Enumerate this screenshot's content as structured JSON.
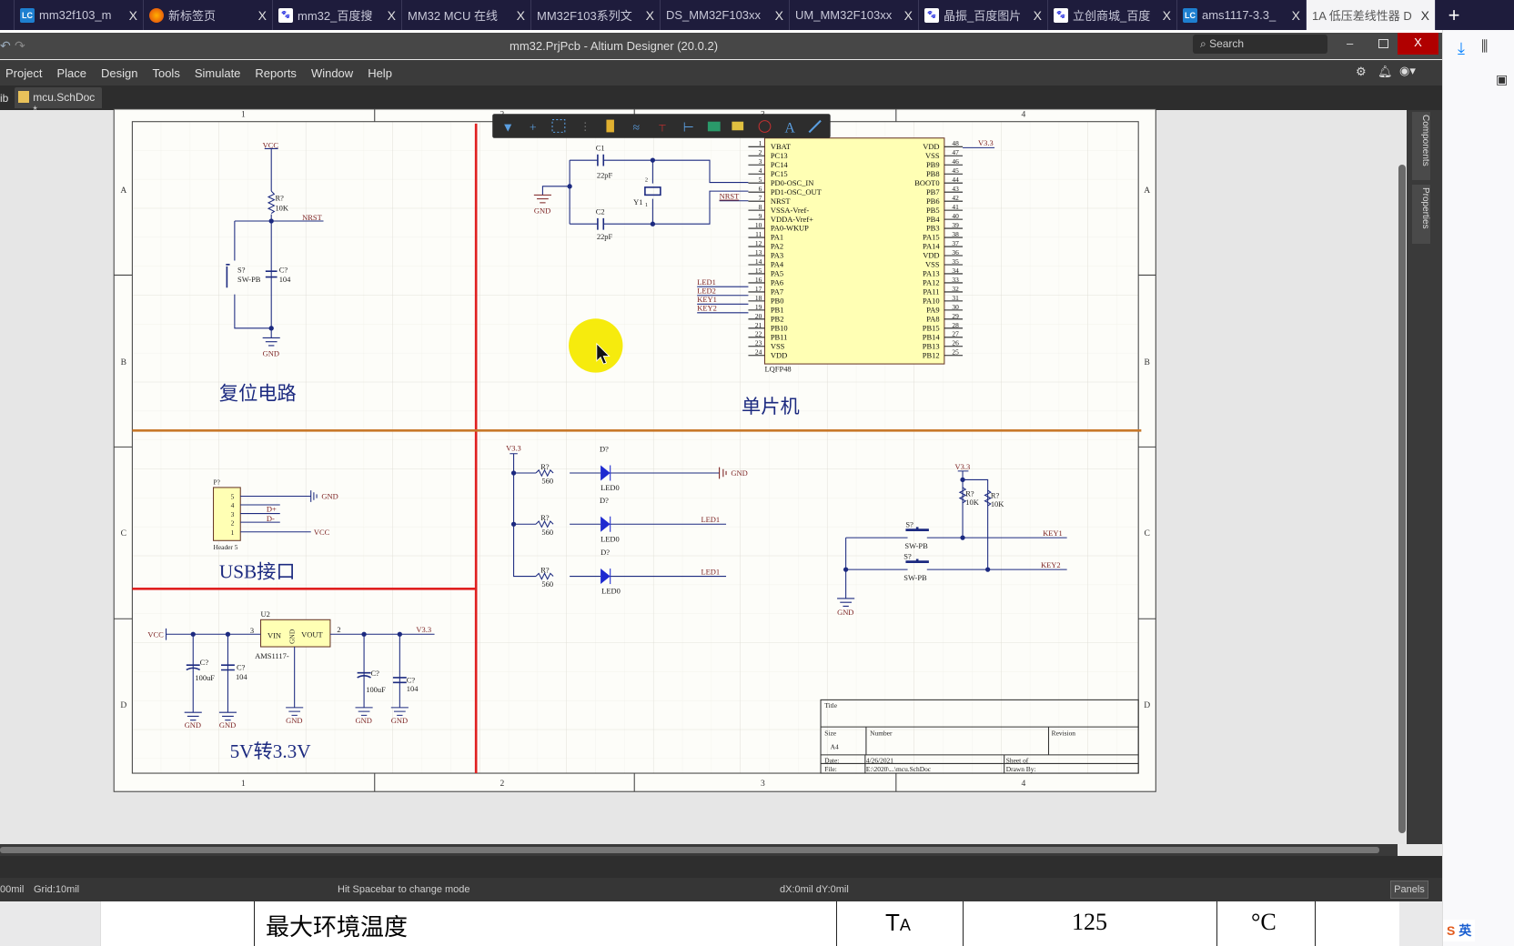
{
  "browser": {
    "tabs": [
      {
        "label": "mm32f103_m",
        "icon": "lc"
      },
      {
        "label": "新标签页",
        "icon": "firefox"
      },
      {
        "label": "mm32_百度搜",
        "icon": "baidu"
      },
      {
        "label": "MM32 MCU 在线",
        "icon": ""
      },
      {
        "label": "MM32F103系列文",
        "icon": ""
      },
      {
        "label": "DS_MM32F103xx",
        "icon": ""
      },
      {
        "label": "UM_MM32F103xx",
        "icon": ""
      },
      {
        "label": "晶振_百度图片",
        "icon": "baidu"
      },
      {
        "label": "立创商城_百度",
        "icon": "baidu"
      },
      {
        "label": "ams1117-3.3_",
        "icon": "lc"
      },
      {
        "label": "1A 低压差线性器 D",
        "icon": "",
        "active": true
      }
    ],
    "new_tab": "+",
    "close": "X",
    "ime": "英"
  },
  "app": {
    "title": "mm32.PrjPcb - Altium Designer (20.0.2)",
    "search_placeholder": "Search",
    "menu": [
      "Project",
      "Place",
      "Design",
      "Tools",
      "Simulate",
      "Reports",
      "Window",
      "Help"
    ],
    "doc_tabs": [
      "ib",
      "mcu.SchDoc *"
    ],
    "side_panels": [
      "Components",
      "Properties"
    ]
  },
  "status": {
    "snap": "00mil",
    "grid": "Grid:10mil",
    "hint": "Hit Spacebar to change mode",
    "delta": "dX:0mil dY:0mil",
    "panels": "Panels"
  },
  "doc_row": {
    "param": "最大环境温度",
    "symbol": "T",
    "symbol_sub": "A",
    "value": "125",
    "unit": "°C"
  },
  "sheet": {
    "columns": [
      "1",
      "2",
      "3",
      "4"
    ],
    "rows": [
      "A",
      "B",
      "C",
      "D"
    ],
    "sections": {
      "reset": "复位电路",
      "mcu": "单片机",
      "usb": "USB接口",
      "power": "5V转3.3V"
    },
    "title_block": {
      "title": "Title",
      "size": "Size",
      "size_value": "A4",
      "number": "Number",
      "revision": "Revision",
      "date": "Date:",
      "date_value": "4/26/2021",
      "file": "File:",
      "file_value": "E:\\2020\\...\\mcu.SchDoc",
      "sheet": "Sheet   of",
      "drawn_by": "Drawn By:"
    }
  },
  "reset": {
    "vcc": "VCC",
    "r_des": "R?",
    "r_val": "10K",
    "net": "NRST",
    "s_des": "S?",
    "s_val": "SW-PB",
    "c_des": "C?",
    "c_val": "104",
    "gnd": "GND"
  },
  "crystal": {
    "c1": "C1",
    "c1_val": "22pF",
    "c2": "C2",
    "c2_val": "22pF",
    "y1": "Y1",
    "pin2": "2",
    "pin1": "1",
    "gnd": "GND",
    "nrst": "NRST"
  },
  "mcu": {
    "package": "LQFP48",
    "power_net": "V3.3",
    "left_nets": [
      "LED1",
      "LED2",
      "KEY1",
      "KEY2"
    ],
    "left_pins": [
      [
        "1",
        "VBAT"
      ],
      [
        "2",
        "PC13"
      ],
      [
        "3",
        "PC14"
      ],
      [
        "4",
        "PC15"
      ],
      [
        "5",
        "PD0-OSC_IN"
      ],
      [
        "6",
        "PD1-OSC_OUT"
      ],
      [
        "7",
        "NRST"
      ],
      [
        "8",
        "VSSA-Vref-"
      ],
      [
        "9",
        "VDDA-Vref+"
      ],
      [
        "10",
        "PA0-WKUP"
      ],
      [
        "11",
        "PA1"
      ],
      [
        "12",
        "PA2"
      ],
      [
        "13",
        "PA3"
      ],
      [
        "14",
        "PA4"
      ],
      [
        "15",
        "PA5"
      ],
      [
        "16",
        "PA6"
      ],
      [
        "17",
        "PA7"
      ],
      [
        "18",
        "PB0"
      ],
      [
        "19",
        "PB1"
      ],
      [
        "20",
        "PB2"
      ],
      [
        "21",
        "PB10"
      ],
      [
        "22",
        "PB11"
      ],
      [
        "23",
        "VSS"
      ],
      [
        "24",
        "VDD"
      ]
    ],
    "right_pins": [
      [
        "48",
        "VDD"
      ],
      [
        "47",
        "VSS"
      ],
      [
        "46",
        "PB9"
      ],
      [
        "45",
        "PB8"
      ],
      [
        "44",
        "BOOT0"
      ],
      [
        "43",
        "PB7"
      ],
      [
        "42",
        "PB6"
      ],
      [
        "41",
        "PB5"
      ],
      [
        "40",
        "PB4"
      ],
      [
        "39",
        "PB3"
      ],
      [
        "38",
        "PA15"
      ],
      [
        "37",
        "PA14"
      ],
      [
        "36",
        "VDD"
      ],
      [
        "35",
        "VSS"
      ],
      [
        "34",
        "PA13"
      ],
      [
        "33",
        "PA12"
      ],
      [
        "32",
        "PA11"
      ],
      [
        "31",
        "PA10"
      ],
      [
        "30",
        "PA9"
      ],
      [
        "29",
        "PA8"
      ],
      [
        "28",
        "PB15"
      ],
      [
        "27",
        "PB14"
      ],
      [
        "26",
        "PB13"
      ],
      [
        "25",
        "PB12"
      ]
    ]
  },
  "leds": {
    "supply": "V3.3",
    "rows": [
      {
        "r_des": "R?",
        "r_val": "560",
        "d_des": "D?",
        "d_val": "LED0",
        "net": "GND"
      },
      {
        "r_des": "R?",
        "r_val": "560",
        "d_des": "D?",
        "d_val": "LED0",
        "net": "LED1"
      },
      {
        "r_des": "R?",
        "r_val": "560",
        "d_des": "D?",
        "d_val": "LED0",
        "net": "LED1"
      }
    ]
  },
  "usb": {
    "des": "P?",
    "val": "Header 5",
    "pins": [
      "5",
      "4",
      "3",
      "2",
      "1"
    ],
    "gnd": "GND",
    "dp": "D+",
    "dm": "D-",
    "vcc": "VCC"
  },
  "power": {
    "vcc": "VCC",
    "u_des": "U2",
    "u_val": "AMS1117-",
    "vin": "VIN",
    "gnd_pin": "GND",
    "vout": "VOUT",
    "pin3": "3",
    "pin2": "2",
    "out_net": "V3.3",
    "caps": [
      {
        "des": "C?",
        "val": "100uF"
      },
      {
        "des": "C?",
        "val": "104"
      },
      {
        "des": "C?",
        "val": "100uF"
      },
      {
        "des": "C?",
        "val": "104"
      }
    ],
    "gnd": "GND"
  },
  "keys": {
    "supply": "V3.3",
    "r1_des": "R?",
    "r1_val": "10K",
    "r2_des": "R?",
    "r2_val": "10K",
    "s1_des": "S?",
    "s1_val": "SW-PB",
    "s2_des": "S?",
    "s2_val": "SW-PB",
    "key1": "KEY1",
    "key2": "KEY2",
    "gnd": "GND"
  },
  "colors": {
    "wire": "#1c2a80",
    "net_label": "#7a1f1f",
    "border_red": "#e02020",
    "divider_orange": "#c8782a",
    "chip_fill": "#ffffb4",
    "tab_bar": "#1e1c3c"
  }
}
